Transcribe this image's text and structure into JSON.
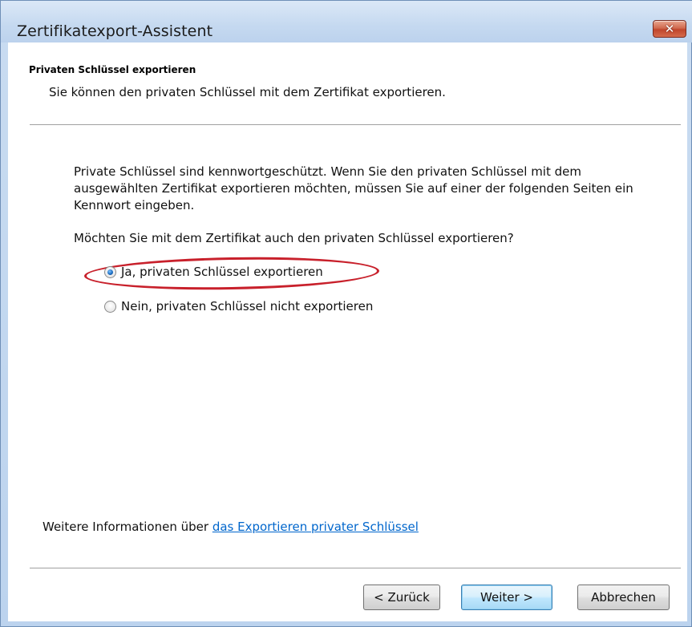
{
  "window": {
    "title": "Zertifikatexport-Assistent",
    "close_glyph": "✕"
  },
  "header": {
    "title": "Privaten Schlüssel exportieren",
    "description": "Sie können den privaten Schlüssel mit dem Zertifikat exportieren."
  },
  "body": {
    "intro": "Private Schlüssel sind kennwortgeschützt. Wenn Sie den privaten Schlüssel mit dem ausgewählten Zertifikat exportieren möchten, müssen Sie auf einer der folgenden Seiten ein Kennwort eingeben.",
    "question": "Möchten Sie mit dem Zertifikat auch den privaten Schlüssel exportieren?",
    "options": [
      {
        "label": "Ja, privaten Schlüssel exportieren",
        "checked": true
      },
      {
        "label": "Nein, privaten Schlüssel nicht exportieren",
        "checked": false
      }
    ],
    "highlight_color": "#c8202b"
  },
  "footer": {
    "more_info_prefix": "Weitere Informationen über ",
    "more_info_link": "das Exportieren privater Schlüssel"
  },
  "buttons": {
    "back": "< Zurück",
    "next": "Weiter >",
    "cancel": "Abbrechen"
  },
  "icons": {
    "close": "close-icon",
    "radio_selected": "radio-selected-icon",
    "radio_unselected": "radio-unselected-icon"
  }
}
